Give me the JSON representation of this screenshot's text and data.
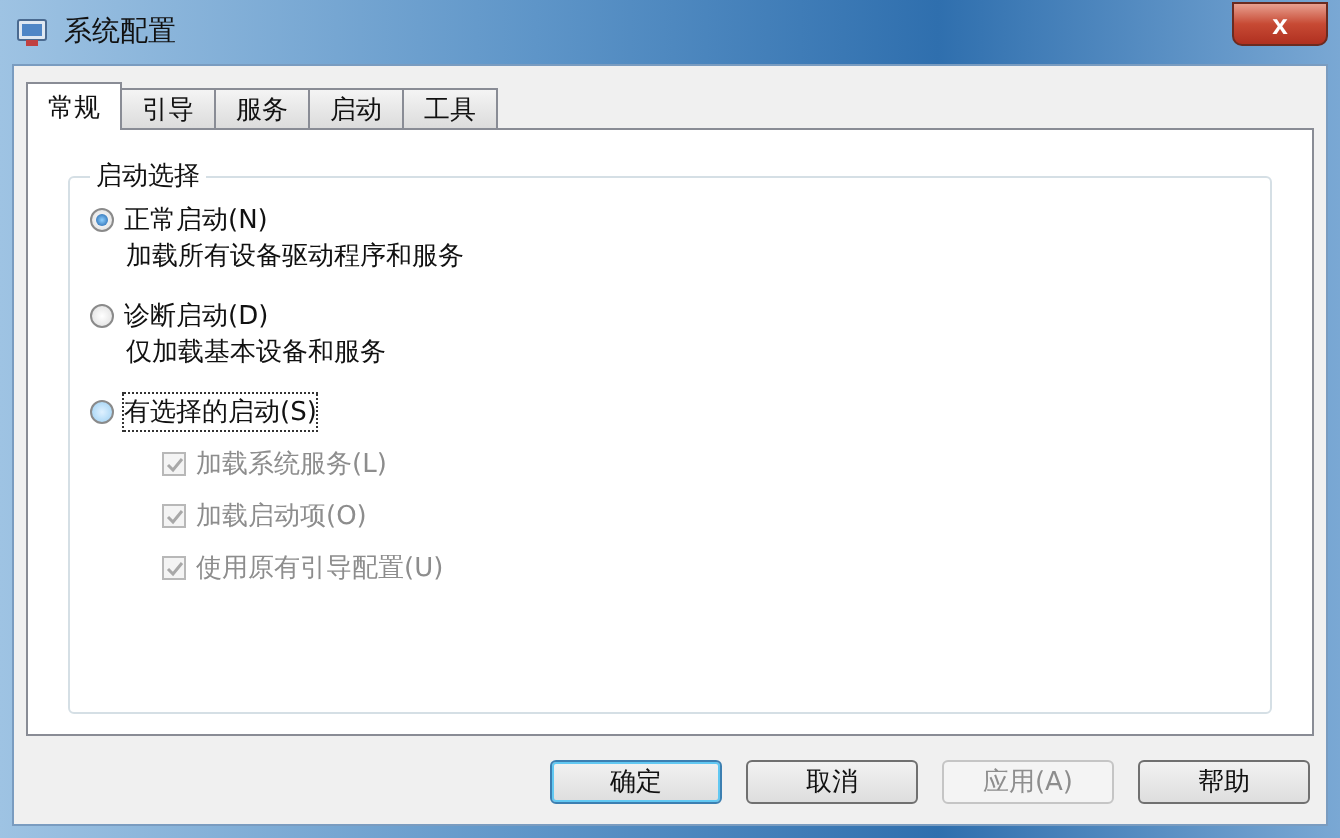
{
  "window": {
    "title": "系统配置",
    "close": "x"
  },
  "tabs": [
    {
      "label": "常规",
      "selected": true
    },
    {
      "label": "引导",
      "selected": false
    },
    {
      "label": "服务",
      "selected": false
    },
    {
      "label": "启动",
      "selected": false
    },
    {
      "label": "工具",
      "selected": false
    }
  ],
  "group": {
    "title": "启动选择"
  },
  "options": [
    {
      "label": "正常启动(N)",
      "description": "加载所有设备驱动程序和服务",
      "selected": true,
      "focused": false
    },
    {
      "label": "诊断启动(D)",
      "description": "仅加载基本设备和服务",
      "selected": false,
      "focused": false
    },
    {
      "label": "有选择的启动(S)",
      "selected": false,
      "focused": true
    }
  ],
  "checkboxes": [
    {
      "label": "加载系统服务(L)",
      "checked": true,
      "disabled": true
    },
    {
      "label": "加载启动项(O)",
      "checked": true,
      "disabled": true
    },
    {
      "label": "使用原有引导配置(U)",
      "checked": true,
      "disabled": true
    }
  ],
  "buttons": [
    {
      "label": "确定",
      "default": true,
      "disabled": false
    },
    {
      "label": "取消",
      "default": false,
      "disabled": false
    },
    {
      "label": "应用(A)",
      "default": false,
      "disabled": true
    },
    {
      "label": "帮助",
      "default": false,
      "disabled": false
    }
  ]
}
